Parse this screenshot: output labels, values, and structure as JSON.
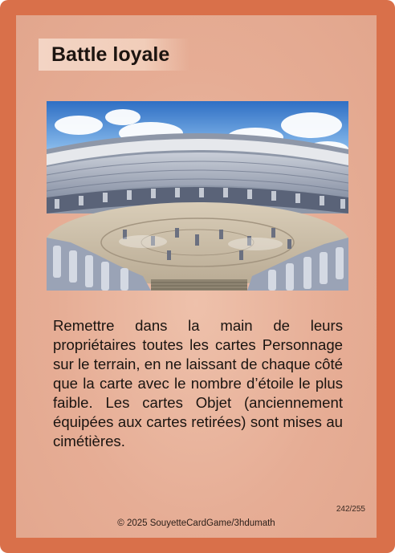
{
  "card": {
    "title": "Battle loyale",
    "illustration": "colosseum-arena-battle",
    "effect_text": "Remettre dans la main de leurs propriétaires toutes les cartes Personnage sur le terrain, en ne laissant de chaque côté que la carte avec le nombre d’étoile le plus faible. Les cartes Objet (anciennement équipées aux cartes retirées) sont mises au cimétières.",
    "card_number": "242/255",
    "copyright": "© 2025 SouyetteCardGame/3hdumath"
  },
  "colors": {
    "frame": "#d9704a",
    "panel": "#e6ad95",
    "title_bg": "#f3d4c4"
  }
}
